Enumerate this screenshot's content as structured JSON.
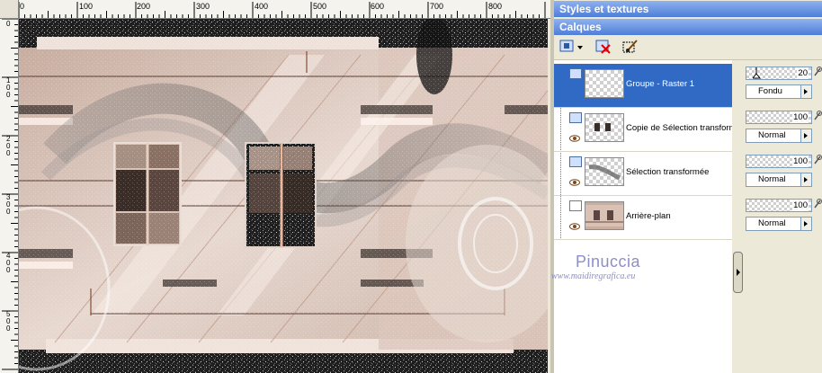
{
  "rulers": {
    "top_labels": [
      "0",
      "100",
      "200",
      "300",
      "400",
      "500",
      "600",
      "700",
      "800"
    ],
    "left_labels": [
      "0",
      "100",
      "200",
      "300",
      "400",
      "500"
    ]
  },
  "panels": {
    "styles_title": "Styles et textures",
    "layers_title": "Calques"
  },
  "layers": [
    {
      "name": "Groupe - Raster 1",
      "opacity": "20",
      "blend": "Fondu",
      "selected": true
    },
    {
      "name": "Copie de Sélection transformée",
      "opacity": "100",
      "blend": "Normal",
      "selected": false
    },
    {
      "name": "Sélection transformée",
      "opacity": "100",
      "blend": "Normal",
      "selected": false
    },
    {
      "name": "Arrière-plan",
      "opacity": "100",
      "blend": "Normal",
      "selected": false
    }
  ],
  "watermark": {
    "title": "Pinuccia",
    "url": "www.maidiregrafica.eu"
  },
  "colors": {
    "selection": "#316ac5",
    "title_bar_top": "#8fb2ef",
    "title_bar_bottom": "#4d7ed8",
    "watermark": "#8e8ec8"
  }
}
